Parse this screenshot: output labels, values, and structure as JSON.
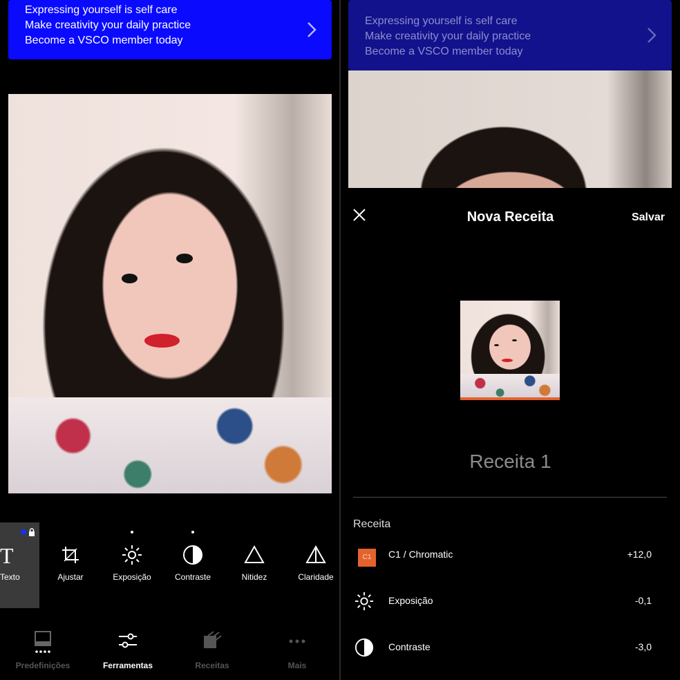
{
  "banner": {
    "lines": [
      "Expressing yourself is self care",
      "Make creativity your daily practice",
      "Become a VSCO member today"
    ]
  },
  "editor": {
    "tools": [
      {
        "label": "Texto",
        "icon": "text-icon"
      },
      {
        "label": "Ajustar",
        "icon": "crop-icon"
      },
      {
        "label": "Exposição",
        "icon": "exposure-sun-icon"
      },
      {
        "label": "Contraste",
        "icon": "contrast-icon"
      },
      {
        "label": "Nitidez",
        "icon": "sharpen-triangle-icon"
      },
      {
        "label": "Claridade",
        "icon": "clarity-triangle-icon"
      }
    ],
    "nav": [
      {
        "label": "Predefinições",
        "icon": "presets-icon"
      },
      {
        "label": "Ferramentas",
        "icon": "tools-sliders-icon"
      },
      {
        "label": "Receitas",
        "icon": "recipes-icon"
      },
      {
        "label": "Mais",
        "icon": "more-dots-icon"
      }
    ]
  },
  "recipe_sheet": {
    "title": "Nova Receita",
    "save_label": "Salvar",
    "recipe_name": "Receita 1",
    "section_label": "Receita",
    "items": [
      {
        "badge": "C1",
        "name": "C1 / Chromatic",
        "value": "+12,0"
      },
      {
        "name": "Exposição",
        "value": "-0,1"
      },
      {
        "name": "Contraste",
        "value": "-3,0"
      }
    ]
  },
  "colors": {
    "banner_blue": "#0a0aff",
    "accent_orange": "#e3632d",
    "lock_badge_blue": "#1330ff"
  }
}
